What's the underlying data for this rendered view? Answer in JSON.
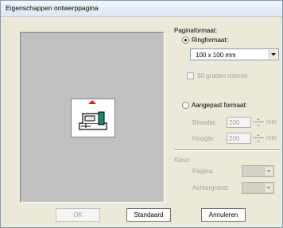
{
  "window": {
    "title": "Eigenschappen ontwerppagina"
  },
  "page_format": {
    "heading": "Paginaformaat:",
    "hoop_option": {
      "label": "Ringformaat:",
      "checked": true
    },
    "hoop_size": {
      "value": "100 x 100 mm"
    },
    "rotate": {
      "label": "90 graden roteren",
      "checked": false,
      "enabled": false
    },
    "custom_option": {
      "label": "Aangepast formaat:",
      "checked": false
    },
    "width": {
      "label": "Breedte:",
      "value": "200",
      "unit": "mm"
    },
    "height": {
      "label": "Hoogte:",
      "value": "200",
      "unit": "mm"
    }
  },
  "color": {
    "heading": "Kleur:",
    "page": {
      "label": "Pagina:"
    },
    "background": {
      "label": "Achtergrond:"
    }
  },
  "buttons": {
    "ok": "OK",
    "default": "Standaard",
    "cancel": "Annuleren"
  },
  "icons": {
    "preview": "embroidery-machine-icon",
    "arrow": "red-up-arrow-icon"
  },
  "colors": {
    "arrow": "#e02020",
    "machine": "#1a8a6a"
  }
}
